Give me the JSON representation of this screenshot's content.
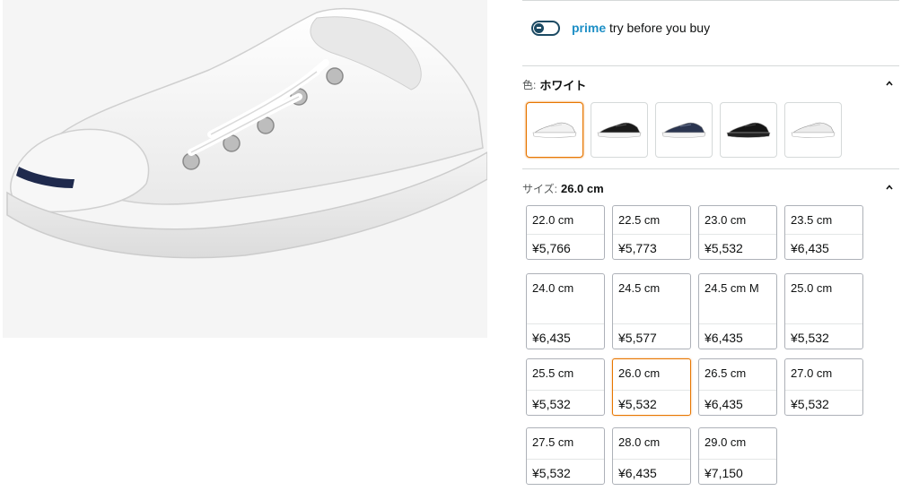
{
  "product_image": {
    "alt": "white canvas sneaker",
    "icon": "shoe-image"
  },
  "prime": {
    "brand": "prime",
    "text": "try before you buy"
  },
  "color_section": {
    "label": "色:",
    "selected": "ホワイト"
  },
  "color_swatches": [
    {
      "name": "white",
      "selected": true,
      "body": "#f2f2f2",
      "sole": "#ffffff",
      "accent": "#d8d8d8"
    },
    {
      "name": "black-white-sole",
      "selected": false,
      "body": "#1a1a1a",
      "sole": "#f4f4f4",
      "accent": "#555555"
    },
    {
      "name": "navy",
      "selected": false,
      "body": "#2b3550",
      "sole": "#f4f4f4",
      "accent": "#6b7690"
    },
    {
      "name": "black",
      "selected": false,
      "body": "#151515",
      "sole": "#222222",
      "accent": "#444444"
    },
    {
      "name": "white-alt",
      "selected": false,
      "body": "#ececec",
      "sole": "#ffffff",
      "accent": "#cfcfcf"
    }
  ],
  "size_section": {
    "label": "サイズ:",
    "selected": "26.0 cm"
  },
  "sizes": [
    {
      "size": "22.0 cm",
      "price": "¥5,766"
    },
    {
      "size": "22.5 cm",
      "price": "¥5,773"
    },
    {
      "size": "23.0 cm",
      "price": "¥5,532"
    },
    {
      "size": "23.5 cm",
      "price": "¥6,435"
    },
    {
      "size": "24.0 cm",
      "price": "¥6,435"
    },
    {
      "size": "24.5 cm",
      "price": "¥5,577"
    },
    {
      "size": "24.5 cm M",
      "price": "¥6,435"
    },
    {
      "size": "25.0 cm",
      "price": "¥5,532"
    },
    {
      "size": "25.5 cm",
      "price": "¥5,532"
    },
    {
      "size": "26.0 cm",
      "price": "¥5,532",
      "selected": true
    },
    {
      "size": "26.5 cm",
      "price": "¥6,435"
    },
    {
      "size": "27.0 cm",
      "price": "¥5,532"
    },
    {
      "size": "27.5 cm",
      "price": "¥5,532"
    },
    {
      "size": "28.0 cm",
      "price": "¥6,435"
    },
    {
      "size": "29.0 cm",
      "price": "¥7,150"
    }
  ],
  "colors": {
    "accent_selected": "#e77600",
    "prime_blue": "#1e8fc6",
    "toggle": "#1c4a63"
  }
}
